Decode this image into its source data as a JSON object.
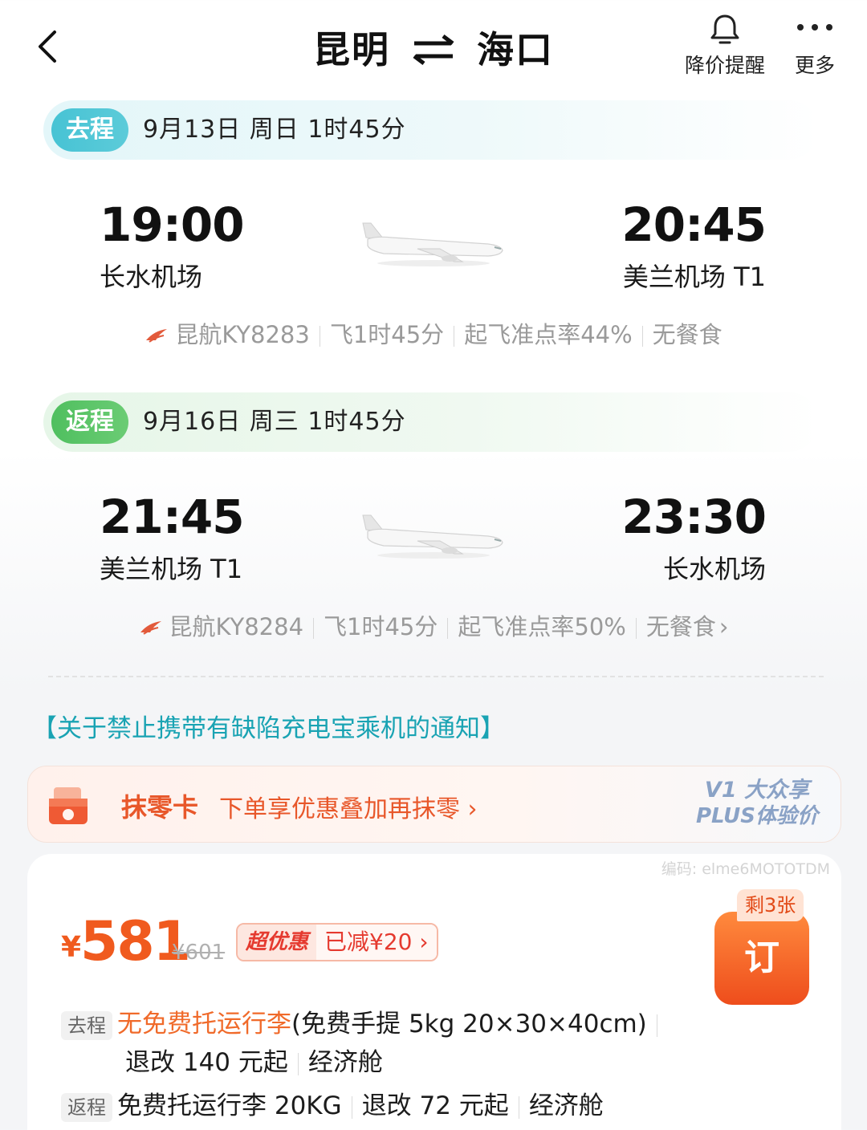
{
  "header": {
    "from_city": "昆明",
    "to_city": "海口",
    "price_alert_label": "降价提醒",
    "more_label": "更多"
  },
  "outbound": {
    "badge": "去程",
    "date_info": "9月13日 周日  1时45分",
    "dep_time": "19:00",
    "dep_airport": "长水机场",
    "arr_time": "20:45",
    "arr_airport": "美兰机场 T1",
    "flight_no": "昆航KY8283",
    "duration": "飞1时45分",
    "ontime": "起飞准点率44%",
    "meal": "无餐食"
  },
  "return": {
    "badge": "返程",
    "date_info": "9月16日 周三  1时45分",
    "dep_time": "21:45",
    "dep_airport": "美兰机场 T1",
    "arr_time": "23:30",
    "arr_airport": "长水机场",
    "flight_no": "昆航KY8284",
    "duration": "飞1时45分",
    "ontime": "起飞准点率50%",
    "meal": "无餐食"
  },
  "notice": "【关于禁止携带有缺陷充电宝乘机的通知】",
  "promo": {
    "title": "抹零卡",
    "desc": "下单享优惠叠加再抹零 ›",
    "plus_line1": "V1 大众享",
    "plus_line2": "PLUS体验价"
  },
  "price_card": {
    "code": "编码: elme6MOTOTDM",
    "currency": "¥",
    "price": "581",
    "orig_price": "¥601",
    "discount_label": "超优惠",
    "discount_value": "已减¥20 ›",
    "remain": "剩3张",
    "book_label": "订",
    "out_tag": "去程",
    "out_baggage": "无免费托运行李",
    "out_carry": "(免费手提 5kg 20×30×40cm)",
    "out_change": "退改 140 元起",
    "out_cabin": "经济舱",
    "ret_tag": "返程",
    "ret_baggage": "免费托运行李 20KG",
    "ret_change": "退改 72 元起",
    "ret_cabin": "经济舱"
  },
  "colors": {
    "accent_orange": "#f05a1e",
    "teal": "#47c3d4",
    "green": "#4fbf5f",
    "notice_teal": "#19a3b3"
  }
}
